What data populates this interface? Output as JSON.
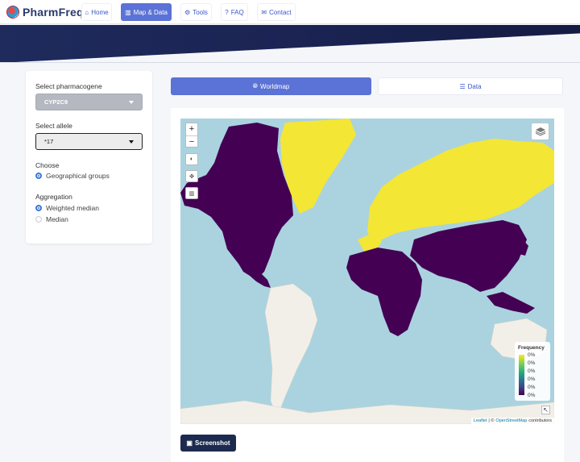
{
  "brand": {
    "name": "PharmFreq"
  },
  "nav": {
    "items": [
      {
        "label": "Home",
        "icon": "home-icon",
        "glyph": "⌂",
        "active": false
      },
      {
        "label": "Map & Data",
        "icon": "map-icon",
        "glyph": "▥",
        "active": true
      },
      {
        "label": "Tools",
        "icon": "gears-icon",
        "glyph": "⚙",
        "active": false
      },
      {
        "label": "FAQ",
        "icon": "question-icon",
        "glyph": "?",
        "active": false
      },
      {
        "label": "Contact",
        "icon": "envelope-icon",
        "glyph": "✉",
        "active": false
      }
    ]
  },
  "sidebar": {
    "pharmacogene_label": "Select pharmacogene",
    "pharmacogene_value": "CYP2C9",
    "allele_label": "Select allele",
    "allele_value": "*17",
    "choose_label": "Choose",
    "choose_option": "Geographical groups",
    "aggregation_label": "Aggregation",
    "aggregation_options": [
      {
        "label": "Weighted median",
        "selected": true
      },
      {
        "label": "Median",
        "selected": false
      }
    ]
  },
  "tabs": {
    "worldmap_label": "Worldmap",
    "data_label": "Data"
  },
  "map": {
    "zoom_in": "+",
    "zoom_out": "−",
    "legend_title": "Frequency",
    "legend_values": [
      "0%",
      "0%",
      "0%",
      "0%",
      "0%",
      "0%"
    ],
    "attribution_leaflet": "Leaflet",
    "attribution_sep": "| ©",
    "attribution_osm": "OpenStreetMap",
    "attribution_suffix": "contributors",
    "colors": {
      "ocean": "#aad3df",
      "no_data": "#f2efe9",
      "high_group": "#f4e635",
      "low_group": "#440154"
    }
  },
  "screenshot_label": "Screenshot"
}
